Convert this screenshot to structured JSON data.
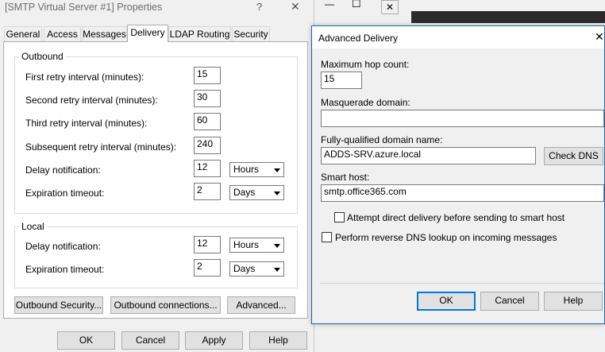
{
  "props": {
    "title": "[SMTP Virtual Server #1] Properties",
    "help_glyph": "?",
    "close_glyph": "✕",
    "tabs": [
      "General",
      "Access",
      "Messages",
      "Delivery",
      "LDAP Routing",
      "Security"
    ],
    "outbound": {
      "legend": "Outbound",
      "first_retry_label": "First retry interval (minutes):",
      "first_retry": "15",
      "second_retry_label": "Second retry interval (minutes):",
      "second_retry": "30",
      "third_retry_label": "Third retry interval (minutes):",
      "third_retry": "60",
      "subsequent_label": "Subsequent retry interval (minutes):",
      "subsequent": "240",
      "delay_label": "Delay notification:",
      "delay_value": "12",
      "delay_unit": "Hours",
      "expire_label": "Expiration timeout:",
      "expire_value": "2",
      "expire_unit": "Days"
    },
    "local": {
      "legend": "Local",
      "delay_label": "Delay notification:",
      "delay_value": "12",
      "delay_unit": "Hours",
      "expire_label": "Expiration timeout:",
      "expire_value": "2",
      "expire_unit": "Days"
    },
    "buttons": {
      "outbound_security": "Outbound Security...",
      "outbound_connections": "Outbound connections...",
      "advanced": "Advanced...",
      "ok": "OK",
      "cancel": "Cancel",
      "apply": "Apply",
      "help": "Help"
    }
  },
  "bg_window": {
    "minimize_glyph": "—",
    "maximize_glyph": "☐",
    "close_glyph": "✕"
  },
  "advanced": {
    "title": "Advanced Delivery",
    "close_glyph": "✕",
    "max_hop_label": "Maximum hop count:",
    "max_hop": "15",
    "masq_label": "Masquerade domain:",
    "masq_value": "",
    "fqdn_label": "Fully-qualified domain name:",
    "fqdn_value": "ADDS-SRV.azure.local",
    "check_dns": "Check DNS",
    "smart_host_label": "Smart host:",
    "smart_host_value": "smtp.office365.com",
    "attempt_direct": "Attempt direct delivery before sending to smart host",
    "reverse_dns": "Perform reverse DNS lookup on incoming messages",
    "ok": "OK",
    "cancel": "Cancel",
    "help": "Help"
  },
  "colors": {
    "focus": "#0078d7",
    "window_bg": "#f0f0f0",
    "dark_strip": "#2b2b2b"
  }
}
